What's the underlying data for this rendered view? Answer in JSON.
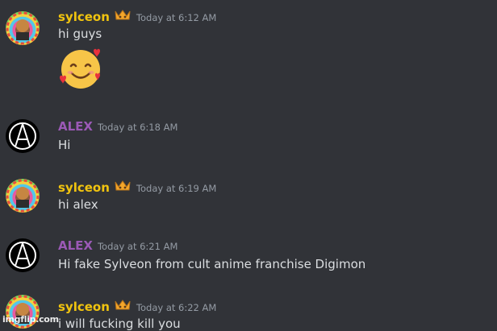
{
  "messages": [
    {
      "username": "sylceon",
      "has_crown": true,
      "timestamp": "Today at 6:12 AM",
      "text": "hi guys",
      "reaction_emoji": "smiling-face-with-hearts-emoji"
    },
    {
      "username": "ALEX",
      "has_crown": false,
      "timestamp": "Today at 6:18 AM",
      "text": "Hi"
    },
    {
      "username": "sylceon",
      "has_crown": true,
      "timestamp": "Today at 6:19 AM",
      "text": "hi alex"
    },
    {
      "username": "ALEX",
      "has_crown": false,
      "timestamp": "Today at 6:21 AM",
      "text": "Hi fake Sylveon from cult anime franchise Digimon"
    },
    {
      "username": "sylceon",
      "has_crown": true,
      "timestamp": "Today at 6:22 AM",
      "text": "i will fucking kill you"
    }
  ],
  "colors": {
    "background": "#313338",
    "sylceon_name": "#f1c40f",
    "alex_name": "#9b59b6",
    "timestamp": "#949ba4",
    "text": "#dbdee1"
  },
  "watermark": "imgflip.com"
}
